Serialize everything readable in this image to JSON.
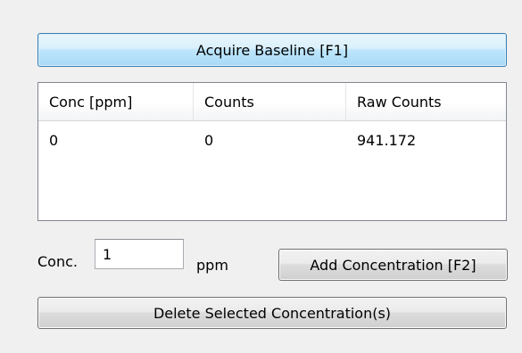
{
  "acquire_button": {
    "label": "Acquire Baseline [F1]"
  },
  "table": {
    "columns": [
      "Conc [ppm]",
      "Counts",
      "Raw Counts"
    ],
    "rows": [
      [
        "0",
        "0",
        "941.172"
      ]
    ]
  },
  "concentration": {
    "label": "Conc.",
    "value": "1",
    "unit": "ppm"
  },
  "add_button": {
    "label": "Add Concentration [F2]"
  },
  "delete_button": {
    "label": "Delete Selected Concentration(s)"
  }
}
